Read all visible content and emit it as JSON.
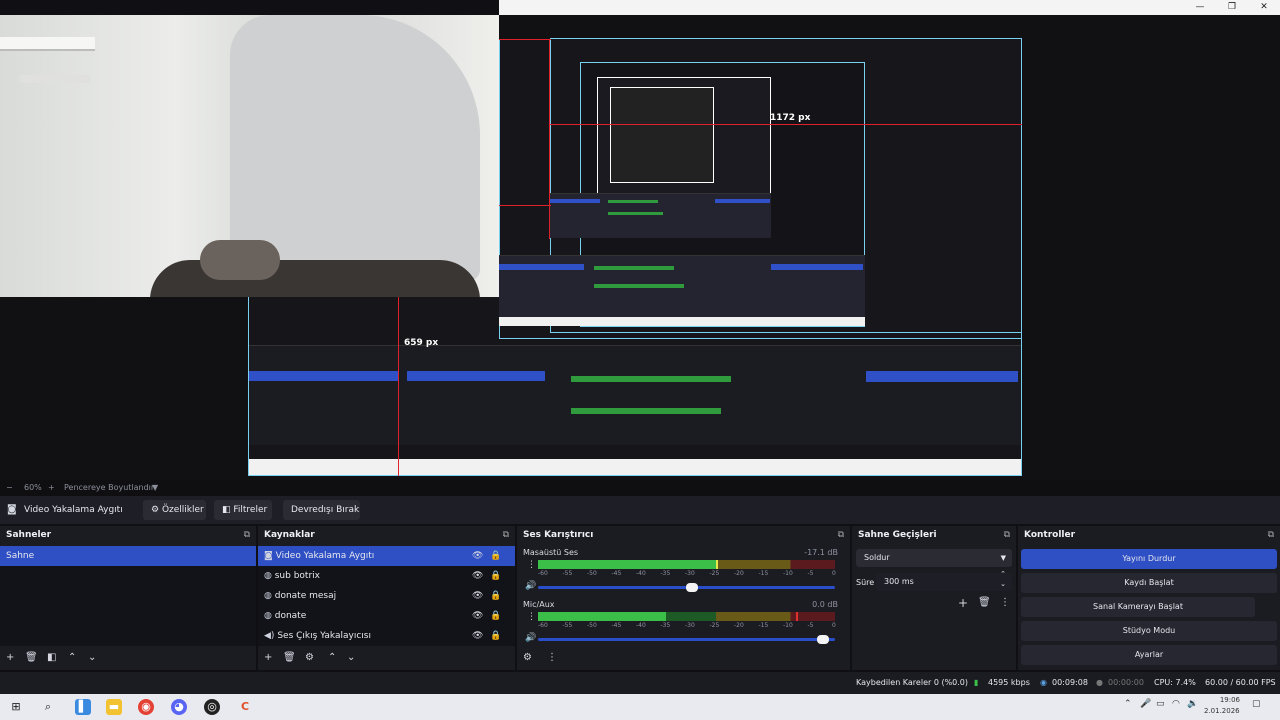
{
  "preview": {
    "zoom_minus": "−",
    "zoom_value": "60%",
    "zoom_plus": "+",
    "fit_label": "Pencereye Boyutlandır",
    "fit_arrow": "▼",
    "measure_horizontal": "1172 px",
    "measure_vertical": "659 px",
    "nested_measure": "1172 px"
  },
  "toolbar": {
    "source_name": "Video Yakalama Aygıtı",
    "properties_label": "Özellikler",
    "filters_label": "Filtreler",
    "deactivate_label": "Devredışı Bırak"
  },
  "scenes": {
    "title": "Sahneler",
    "items": [
      {
        "label": "Sahne",
        "selected": true
      }
    ]
  },
  "sources": {
    "title": "Kaynaklar",
    "items": [
      {
        "label": "Video Yakalama Aygıtı",
        "icon": "camera-icon",
        "selected": true
      },
      {
        "label": "sub botrix",
        "icon": "globe-icon"
      },
      {
        "label": "donate mesaj",
        "icon": "globe-icon"
      },
      {
        "label": "donate",
        "icon": "globe-icon"
      },
      {
        "label": "Ses Çıkış Yakalayıcısı",
        "icon": "speaker-icon"
      }
    ]
  },
  "mixer": {
    "title": "Ses Karıştırıcı",
    "ticks": [
      "-60",
      "-55",
      "-50",
      "-45",
      "-40",
      "-35",
      "-30",
      "-25",
      "-20",
      "-15",
      "-10",
      "-5",
      "0"
    ],
    "channels": [
      {
        "name": "Masaüstü Ses",
        "db": "-17.1 dB",
        "level": 0.6,
        "peak": 0.6,
        "volume": 0.52
      },
      {
        "name": "Mic/Aux",
        "db": "0.0 dB",
        "level": 0.43,
        "peak": 0.87,
        "volume": 0.98
      }
    ]
  },
  "transitions": {
    "title": "Sahne Geçişleri",
    "type_value": "Soldur",
    "duration_label": "Süre",
    "duration_value": "300 ms"
  },
  "controls": {
    "title": "Kontroller",
    "stop_stream": "Yayını Durdur",
    "start_recording": "Kaydı Başlat",
    "start_virtualcam": "Sanal Kamerayı Başlat",
    "studio_mode": "Stüdyo Modu",
    "settings": "Ayarlar"
  },
  "status": {
    "dropped_frames": "Kaybedilen Kareler 0 (%0.0)",
    "bitrate": "4595 kbps",
    "stream_time": "00:09:08",
    "record_time": "00:00:00",
    "cpu": "CPU: 7.4%",
    "fps": "60.00 / 60.00 FPS"
  },
  "taskbar": {
    "time": "19:06",
    "date": "2.01.2026"
  },
  "colors": {
    "accent": "#2f4fc4",
    "meter_green": "#3cbf49",
    "measure_red": "#e0202a",
    "capture_border": "#7ad0f0"
  }
}
